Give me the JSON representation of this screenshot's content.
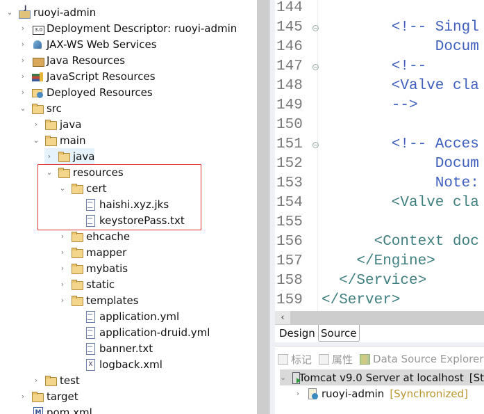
{
  "project_explorer": {
    "items": [
      {
        "label": "ruoyi-admin",
        "level": 0,
        "arrow": "expanded",
        "icon": "web-project-icon"
      },
      {
        "label": "Deployment Descriptor: ruoyi-admin",
        "level": 1,
        "arrow": "collapsed",
        "icon": "deployment-descriptor-icon"
      },
      {
        "label": "JAX-WS Web Services",
        "level": 1,
        "arrow": "collapsed",
        "icon": "web-services-icon"
      },
      {
        "label": "Java Resources",
        "level": 1,
        "arrow": "collapsed",
        "icon": "java-resources-icon"
      },
      {
        "label": "JavaScript Resources",
        "level": 1,
        "arrow": "collapsed",
        "icon": "javascript-resources-icon"
      },
      {
        "label": "Deployed Resources",
        "level": 1,
        "arrow": "collapsed",
        "icon": "deployed-resources-icon"
      },
      {
        "label": "src",
        "level": 1,
        "arrow": "expanded",
        "icon": "folder-icon"
      },
      {
        "label": "java",
        "level": 2,
        "arrow": "collapsed",
        "icon": "folder-icon"
      },
      {
        "label": "main",
        "level": 2,
        "arrow": "expanded",
        "icon": "folder-icon"
      },
      {
        "label": "java",
        "level": 3,
        "arrow": "collapsed",
        "icon": "folder-icon",
        "selected": true
      },
      {
        "label": "resources",
        "level": 3,
        "arrow": "expanded",
        "icon": "folder-icon"
      },
      {
        "label": "cert",
        "level": 4,
        "arrow": "expanded",
        "icon": "folder-icon"
      },
      {
        "label": "haishi.xyz.jks",
        "level": 5,
        "arrow": "none",
        "icon": "file-icon"
      },
      {
        "label": "keystorePass.txt",
        "level": 5,
        "arrow": "none",
        "icon": "file-icon"
      },
      {
        "label": "ehcache",
        "level": 4,
        "arrow": "collapsed",
        "icon": "folder-icon"
      },
      {
        "label": "mapper",
        "level": 4,
        "arrow": "collapsed",
        "icon": "folder-icon"
      },
      {
        "label": "mybatis",
        "level": 4,
        "arrow": "collapsed",
        "icon": "folder-icon"
      },
      {
        "label": "static",
        "level": 4,
        "arrow": "collapsed",
        "icon": "folder-icon"
      },
      {
        "label": "templates",
        "level": 4,
        "arrow": "collapsed",
        "icon": "folder-icon"
      },
      {
        "label": "application.yml",
        "level": 5,
        "arrow": "none",
        "icon": "file-icon"
      },
      {
        "label": "application-druid.yml",
        "level": 5,
        "arrow": "none",
        "icon": "file-icon"
      },
      {
        "label": "banner.txt",
        "level": 5,
        "arrow": "none",
        "icon": "file-icon"
      },
      {
        "label": "logback.xml",
        "level": 5,
        "arrow": "none",
        "icon": "xml-file-icon"
      },
      {
        "label": "test",
        "level": 2,
        "arrow": "collapsed",
        "icon": "folder-icon"
      },
      {
        "label": "target",
        "level": 1,
        "arrow": "collapsed",
        "icon": "folder-icon"
      },
      {
        "label": "pom.xml",
        "level": 1,
        "arrow": "none",
        "icon": "maven-pom-icon"
      }
    ]
  },
  "editor": {
    "lines": [
      {
        "num": "144",
        "text": "",
        "indent": 0,
        "fold": false,
        "kind": "t"
      },
      {
        "num": "145",
        "text": "<!-- Singl",
        "indent": 8,
        "fold": true,
        "kind": "c"
      },
      {
        "num": "146",
        "text": "Docum",
        "indent": 13,
        "fold": false,
        "kind": "c"
      },
      {
        "num": "147",
        "text": "<!--",
        "indent": 8,
        "fold": true,
        "kind": "c"
      },
      {
        "num": "148",
        "text": "<Valve cla",
        "indent": 8,
        "fold": false,
        "kind": "c"
      },
      {
        "num": "149",
        "text": "-->",
        "indent": 8,
        "fold": false,
        "kind": "c"
      },
      {
        "num": "150",
        "text": "",
        "indent": 0,
        "fold": false,
        "kind": "t"
      },
      {
        "num": "151",
        "text": "<!-- Acces",
        "indent": 8,
        "fold": true,
        "kind": "c"
      },
      {
        "num": "152",
        "text": "Docum",
        "indent": 13,
        "fold": false,
        "kind": "c"
      },
      {
        "num": "153",
        "text": "Note:",
        "indent": 13,
        "fold": false,
        "kind": "c"
      },
      {
        "num": "154",
        "text": "<Valve cla",
        "indent": 8,
        "fold": false,
        "kind": "t"
      },
      {
        "num": "155",
        "text": "",
        "indent": 0,
        "fold": false,
        "kind": "t"
      },
      {
        "num": "156",
        "text": "<Context doc",
        "indent": 6,
        "fold": false,
        "kind": "t"
      },
      {
        "num": "157",
        "text": "</Engine>",
        "indent": 4,
        "fold": false,
        "kind": "t"
      },
      {
        "num": "158",
        "text": "</Service>",
        "indent": 2,
        "fold": false,
        "kind": "t"
      },
      {
        "num": "159",
        "text": "</Server>",
        "indent": 0,
        "fold": false,
        "kind": "t"
      }
    ],
    "tabs": {
      "design": "Design",
      "source": "Source",
      "active": "Source"
    }
  },
  "servers_panel": {
    "toolbar": [
      {
        "label": "标记",
        "icon": "markers-icon"
      },
      {
        "label": "属性",
        "icon": "properties-icon"
      },
      {
        "label": "Data Source Explorer",
        "icon": "data-source-explorer-icon"
      }
    ],
    "server": {
      "label": "Tomcat v9.0 Server at localhost",
      "status": "[St"
    },
    "module": {
      "label": "ruoyi-admin",
      "state": "[Synchronized]"
    }
  },
  "colors": {
    "highlight_box": "#e03030",
    "comment": "#3f5fbf",
    "tag": "#3f7f7f",
    "sync_state": "#b8962e"
  }
}
